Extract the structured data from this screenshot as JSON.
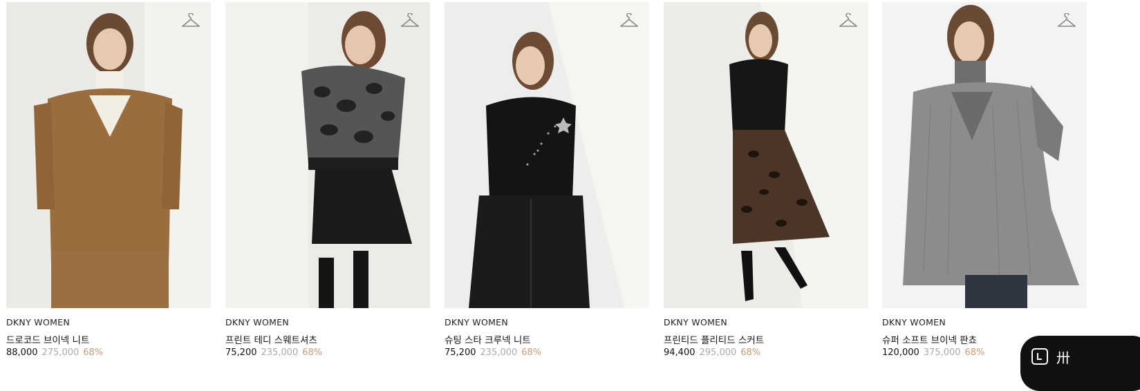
{
  "products": [
    {
      "brand": "DKNY WOMEN",
      "name": "드로코드 브이넥 니트",
      "sale_price": "88,000",
      "original_price": "275,000",
      "discount": "68%"
    },
    {
      "brand": "DKNY WOMEN",
      "name": "프린트 테디 스웨트셔츠",
      "sale_price": "75,200",
      "original_price": "235,000",
      "discount": "68%"
    },
    {
      "brand": "DKNY WOMEN",
      "name": "슈팅 스타 크루넥 니트",
      "sale_price": "75,200",
      "original_price": "235,000",
      "discount": "68%"
    },
    {
      "brand": "DKNY WOMEN",
      "name": "프린티드 플리티드 스커트",
      "sale_price": "94,400",
      "original_price": "295,000",
      "discount": "68%"
    },
    {
      "brand": "DKNY WOMEN",
      "name": "슈퍼 소프트 브이넥 판쵸",
      "sale_price": "120,000",
      "original_price": "375,000",
      "discount": "68%"
    }
  ],
  "icons": {
    "wishlist": "hanger-icon",
    "floating": "chat-icon"
  },
  "floating_glyph": "卅",
  "colors": {
    "discount": "#c79c7a",
    "original_price": "#aaaaaa"
  }
}
